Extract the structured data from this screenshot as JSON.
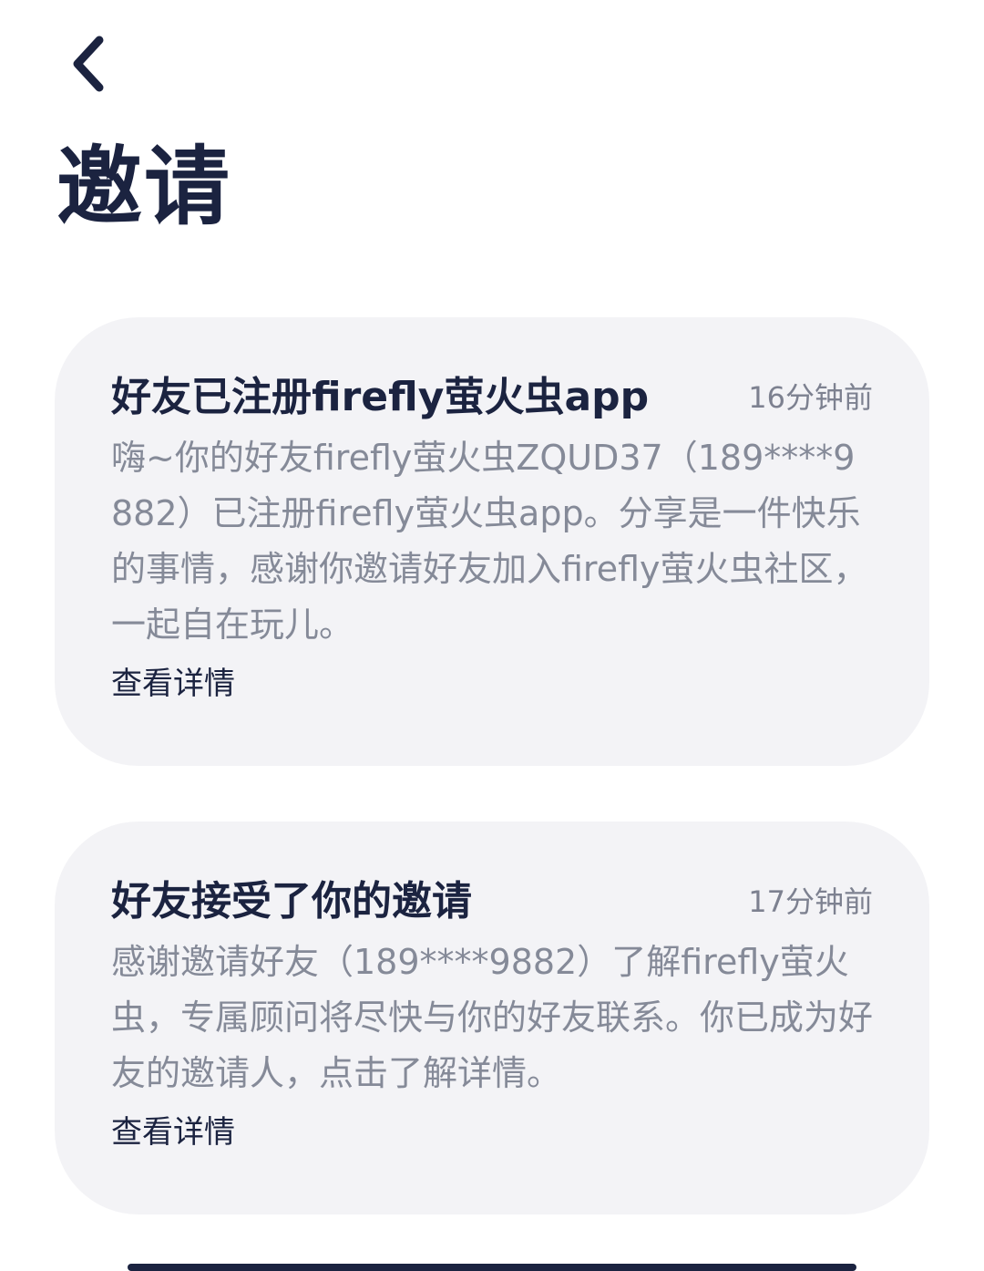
{
  "header": {
    "back_icon": "chevron-left-icon",
    "title": "邀请"
  },
  "messages": [
    {
      "title": "好友已注册firefly萤火虫app",
      "time": "16分钟前",
      "body": "嗨~你的好友firefly萤火虫ZQUD37（189****9882）已注册firefly萤火虫app。分享是一件快乐的事情，感谢你邀请好友加入firefly萤火虫社区，一起自在玩儿。",
      "link": "查看详情"
    },
    {
      "title": "好友接受了你的邀请",
      "time": "17分钟前",
      "body": "感谢邀请好友（189****9882）了解firefly萤火虫，专属顾问将尽快与你的好友联系。你已成为好友的邀请人，点击了解详情。",
      "link": "查看详情"
    }
  ],
  "colors": {
    "text_primary": "#1b2340",
    "text_secondary": "#858a98",
    "card_background": "#f3f3f6"
  }
}
